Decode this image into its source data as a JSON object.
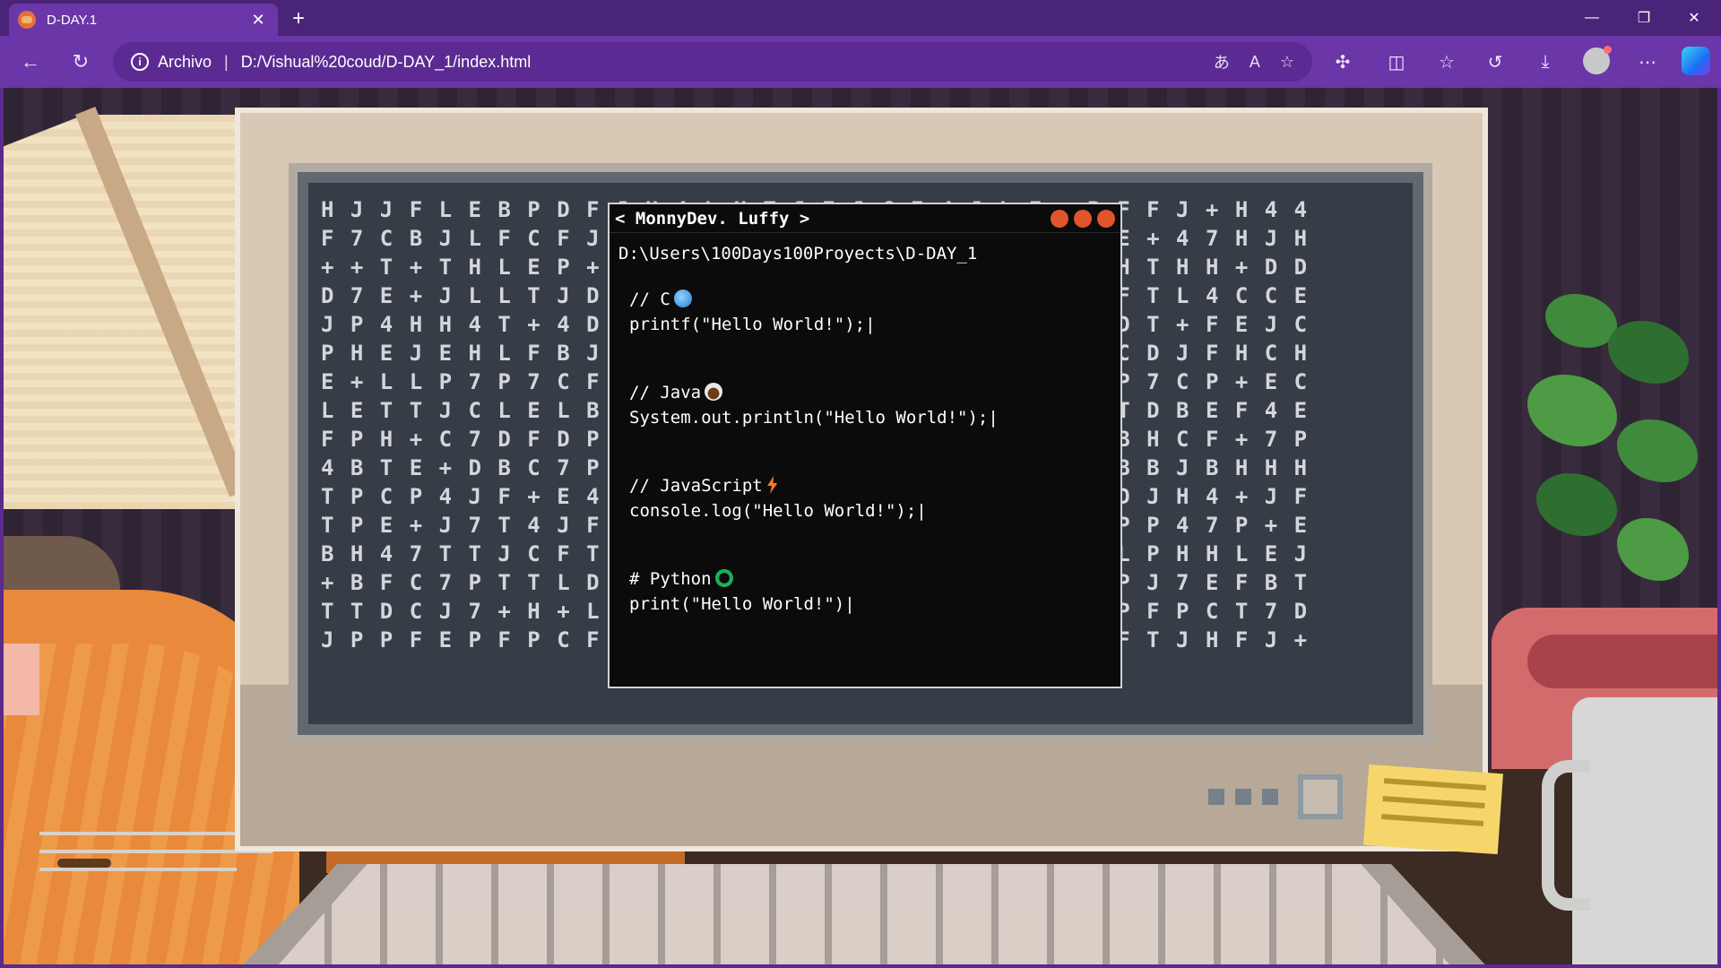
{
  "browser": {
    "tab": {
      "title": "D-DAY.1"
    },
    "address": {
      "site_info": "Archivo",
      "separator": "|",
      "url": "D:/Vishual%20coud/D-DAY_1/index.html"
    },
    "window_controls": {
      "minimize": "—",
      "restore": "❐",
      "close": "✕"
    }
  },
  "terminal": {
    "title": "< MonnyDev. Luffy >",
    "path": "D:\\Users\\100Days100Proyects\\D-DAY_1",
    "blocks": [
      {
        "comment": "// C",
        "icon": "globe-icon",
        "code": "printf(\"Hello World!\");|"
      },
      {
        "comment": "// Java",
        "icon": "coffee-icon",
        "code": "System.out.println(\"Hello World!\");|"
      },
      {
        "comment": "// JavaScript",
        "icon": "lightning-icon",
        "code": "console.log(\"Hello World!\");|"
      },
      {
        "comment": "# Python",
        "icon": "python-icon",
        "code": "print(\"Hello World!\")|"
      }
    ]
  },
  "colors": {
    "browser_frame": "#4a2478",
    "toolbar": "#6b36a8",
    "terminal_bg": "#0b0b0c",
    "terminal_dot": "#e0552c"
  }
}
